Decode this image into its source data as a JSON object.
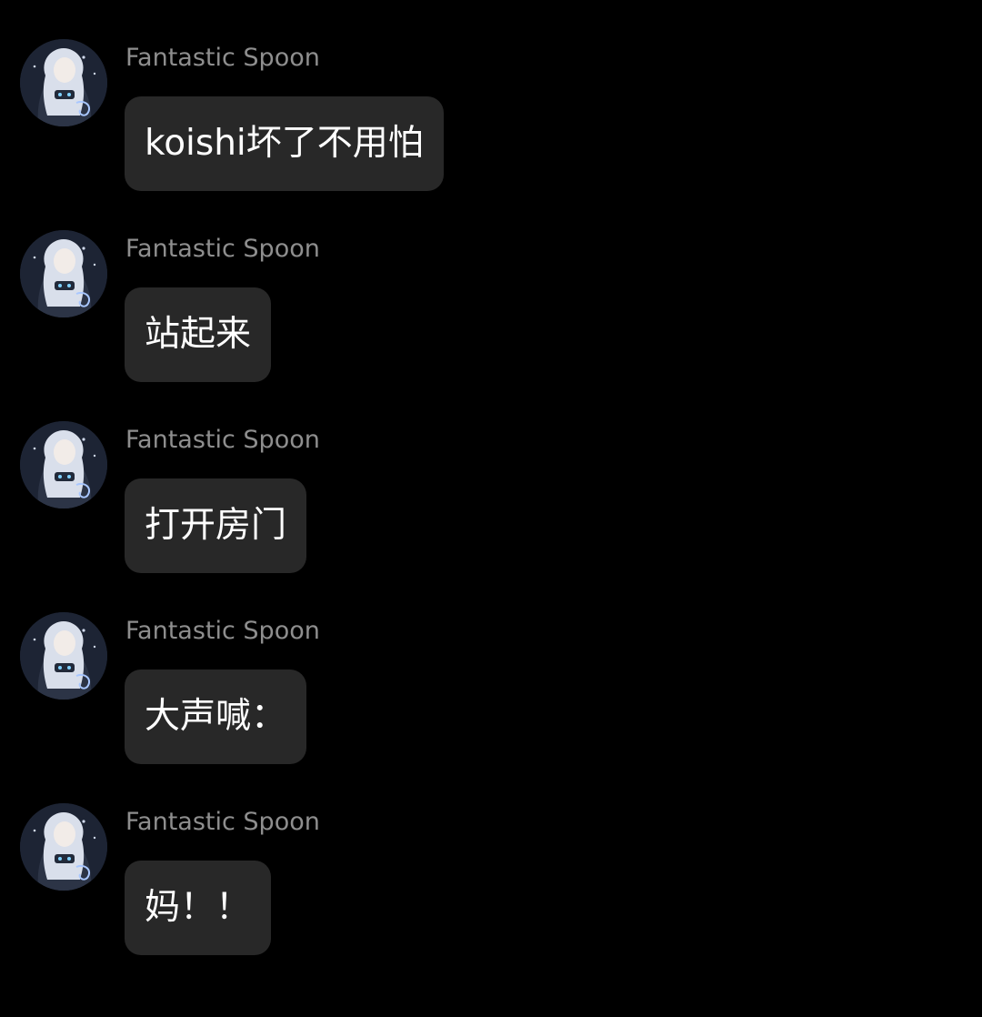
{
  "colors": {
    "background": "#000000",
    "bubble": "#282828",
    "sender_text": "#8e8e8e",
    "message_text": "#ffffff"
  },
  "messages": [
    {
      "sender": "Fantastic Spoon",
      "text": "koishi坏了不用怕",
      "avatar_icon": "anime-character-avatar-icon"
    },
    {
      "sender": "Fantastic Spoon",
      "text": "站起来",
      "avatar_icon": "anime-character-avatar-icon"
    },
    {
      "sender": "Fantastic Spoon",
      "text": "打开房门",
      "avatar_icon": "anime-character-avatar-icon"
    },
    {
      "sender": "Fantastic Spoon",
      "text": "大声喊：",
      "avatar_icon": "anime-character-avatar-icon"
    },
    {
      "sender": "Fantastic Spoon",
      "text": "妈！！",
      "avatar_icon": "anime-character-avatar-icon"
    }
  ]
}
